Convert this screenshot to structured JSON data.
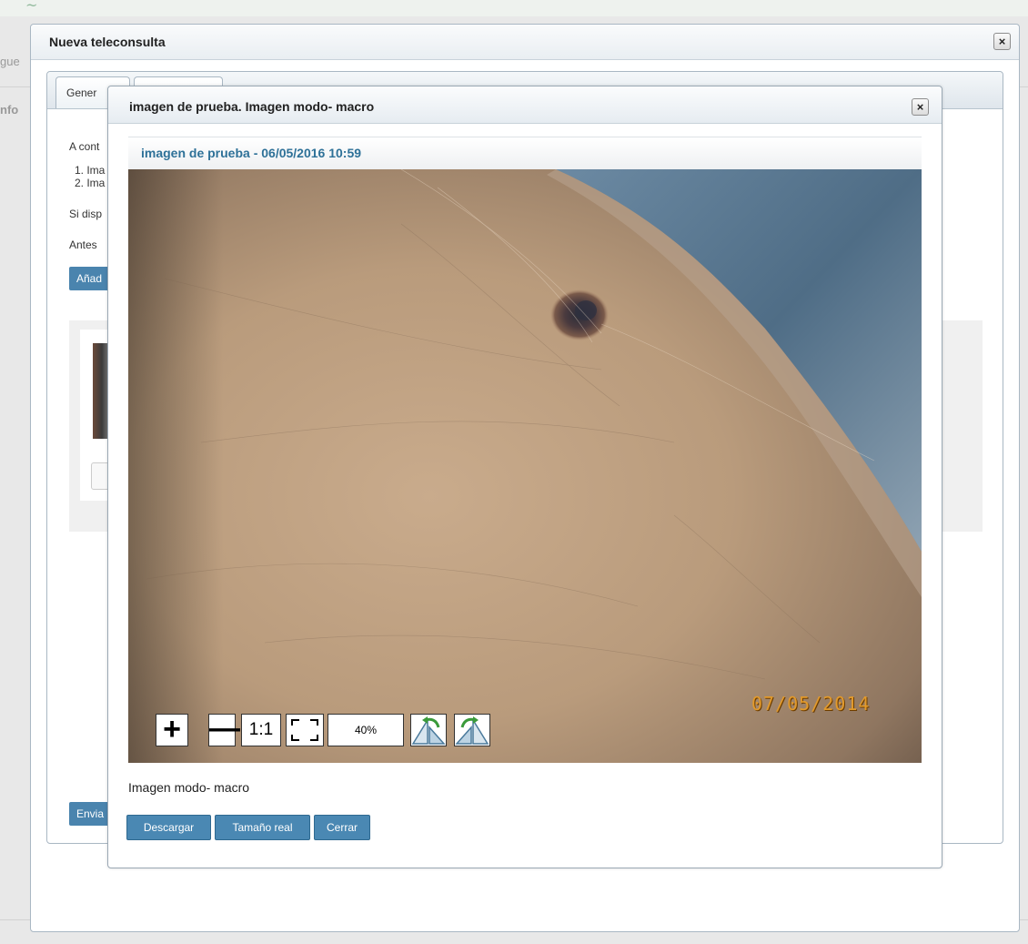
{
  "background": {
    "left_edge_text": [
      "gue",
      "nfo"
    ]
  },
  "outer_modal": {
    "title": "Nueva teleconsulta",
    "close_icon": "×",
    "tabs": [
      {
        "label": "Gener"
      },
      {
        "label": ""
      }
    ],
    "content_lines": [
      "A cont",
      "1. Ima",
      "2. Ima",
      "Si disp",
      "Antes"
    ],
    "add_button_label": "Añad",
    "send_button_label": "Envia"
  },
  "inner_modal": {
    "title": "imagen de prueba. Imagen modo- macro",
    "close_icon": "×",
    "image_header": "imagen de prueba - 06/05/2016 10:59",
    "photo_date_stamp": "07/05/2014",
    "toolbar": {
      "zoom_in": "+",
      "zoom_out": "—",
      "actual": "1:1",
      "zoom_level": "40%"
    },
    "caption": "Imagen modo- macro",
    "buttons": {
      "download": "Descargar",
      "real_size": "Tamaño real",
      "close": "Cerrar"
    }
  }
}
